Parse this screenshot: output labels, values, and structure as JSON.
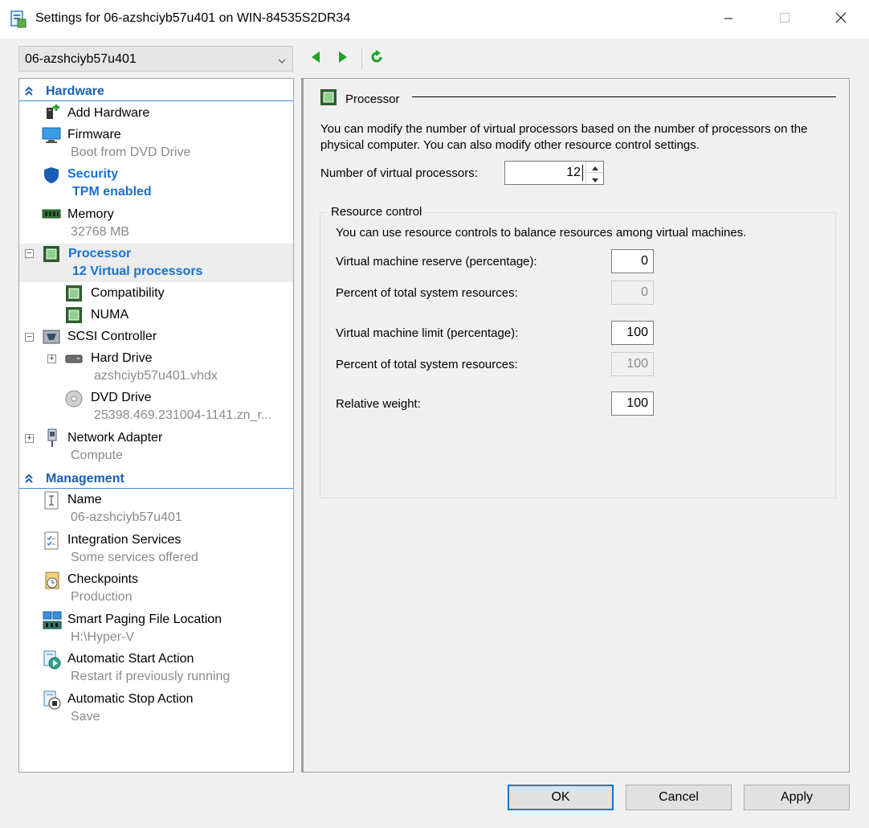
{
  "window": {
    "title": "Settings for 06-azshciyb57u401 on WIN-84535S2DR34"
  },
  "vm_selector": {
    "value": "06-azshciyb57u401"
  },
  "tree": {
    "hardware_header": "Hardware",
    "management_header": "Management",
    "items": [
      {
        "label": "Add Hardware",
        "sub": ""
      },
      {
        "label": "Firmware",
        "sub": "Boot from DVD Drive"
      },
      {
        "label": "Security",
        "sub": "TPM enabled"
      },
      {
        "label": "Memory",
        "sub": "32768 MB"
      },
      {
        "label": "Processor",
        "sub": "12 Virtual processors"
      },
      {
        "label": "Compatibility",
        "sub": ""
      },
      {
        "label": "NUMA",
        "sub": ""
      },
      {
        "label": "SCSI Controller",
        "sub": ""
      },
      {
        "label": "Hard Drive",
        "sub": "azshciyb57u401.vhdx"
      },
      {
        "label": "DVD Drive",
        "sub": "25398.469.231004-1141.zn_r..."
      },
      {
        "label": "Network Adapter",
        "sub": "Compute"
      },
      {
        "label": "Name",
        "sub": "06-azshciyb57u401"
      },
      {
        "label": "Integration Services",
        "sub": "Some services offered"
      },
      {
        "label": "Checkpoints",
        "sub": "Production"
      },
      {
        "label": "Smart Paging File Location",
        "sub": "H:\\Hyper-V"
      },
      {
        "label": "Automatic Start Action",
        "sub": "Restart if previously running"
      },
      {
        "label": "Automatic Stop Action",
        "sub": "Save"
      }
    ]
  },
  "detail": {
    "section_title": "Processor",
    "description": "You can modify the number of virtual processors based on the number of processors on the physical computer. You can also modify other resource control settings.",
    "num_processors_label": "Number of virtual processors:",
    "num_processors_value": "12",
    "resource_control": {
      "title": "Resource control",
      "description": "You can use resource controls to balance resources among virtual machines.",
      "reserve_label": "Virtual machine reserve (percentage):",
      "reserve_value": "0",
      "reserve_pct_label": "Percent of total system resources:",
      "reserve_pct_value": "0",
      "limit_label": "Virtual machine limit (percentage):",
      "limit_value": "100",
      "limit_pct_label": "Percent of total system resources:",
      "limit_pct_value": "100",
      "weight_label": "Relative weight:",
      "weight_value": "100"
    }
  },
  "buttons": {
    "ok": "OK",
    "cancel": "Cancel",
    "apply": "Apply"
  },
  "colors": {
    "accent": "#0078d7",
    "section_header": "#1a5fb4",
    "selected_text": "#1a6fd0",
    "nav_green": "#1fa02a"
  }
}
